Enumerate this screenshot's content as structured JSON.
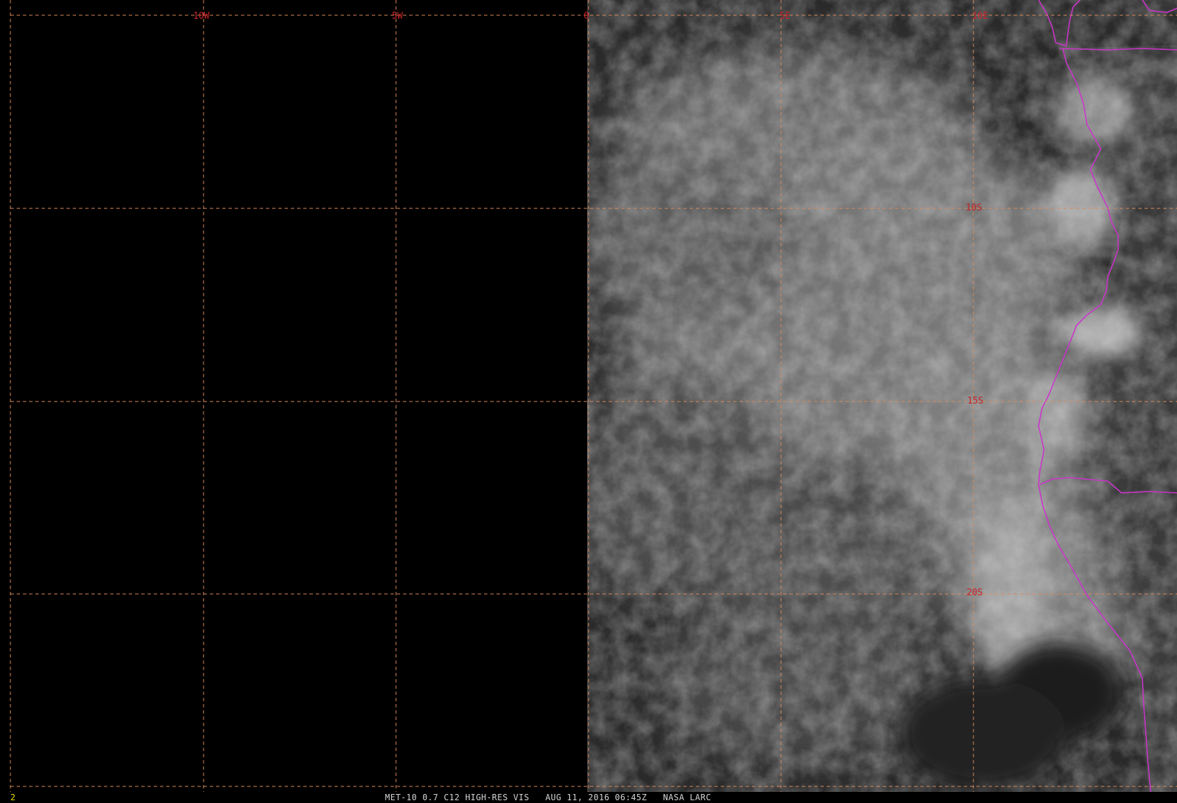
{
  "image": {
    "satellite": "MET-10",
    "channel": "0.7 C12 HIGH-RES VIS",
    "date_time": "AUG 11, 2016 06:45Z",
    "source": "NASA LARC",
    "caption": "MET-10 0.7 C12 HIGH-RES VIS   AUG 11, 2016 06:45Z   NASA LARC",
    "frame_index": "2"
  },
  "grid": {
    "longitude_labels": [
      "10W",
      "5W",
      "0",
      "5E",
      "10E"
    ],
    "latitude_labels": [
      "10S",
      "15S",
      "20S"
    ],
    "line_color": "#d98a5a",
    "label_color": "#c8232a"
  },
  "overlay": {
    "border_color": "#cc33cc",
    "cloud_color": "#bdbdbd",
    "background_color": "#000000"
  }
}
